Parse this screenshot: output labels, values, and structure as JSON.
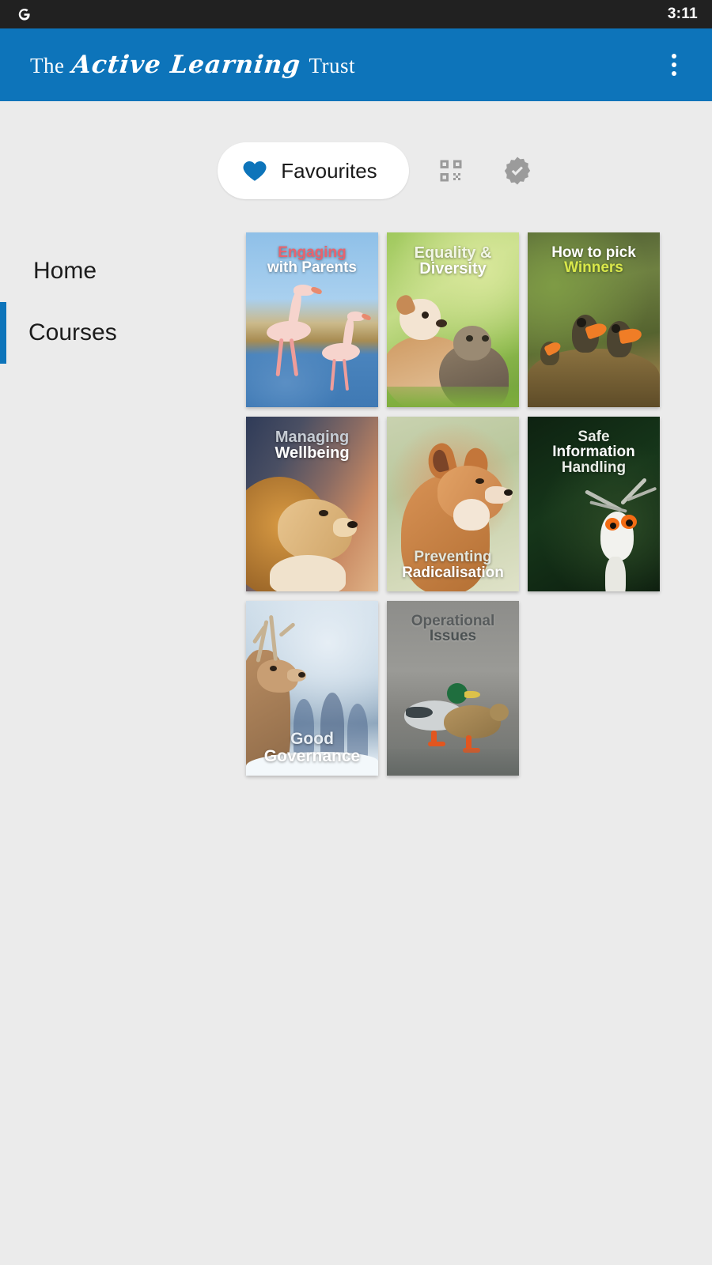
{
  "status_bar": {
    "left_icon": "google-g-icon",
    "time": "3:11"
  },
  "app_bar": {
    "brand_prefix": "The",
    "brand_script": "Active Learning",
    "brand_suffix": "Trust",
    "overflow_icon": "more-vert-icon",
    "background_color": "#0d74ba"
  },
  "tabs": [
    {
      "id": "favourites",
      "label": "Favourites",
      "icon": "heart-icon",
      "selected": true
    },
    {
      "id": "qr",
      "label": "",
      "icon": "qr-code-icon",
      "selected": false
    },
    {
      "id": "certified",
      "label": "",
      "icon": "verified-badge-icon",
      "selected": false
    }
  ],
  "sidebar": {
    "items": [
      {
        "label": "Home",
        "active": false
      },
      {
        "label": "Courses",
        "active": true
      }
    ],
    "active_indicator_color": "#0d74ba"
  },
  "courses": [
    {
      "title_lines": [
        "Engaging",
        "with Parents"
      ],
      "line_colors": [
        "#e8636e",
        "#ffffff"
      ],
      "title_position": "top",
      "font_size": "19px",
      "art": "art-flamingo",
      "image_alt": "two flamingos wading in blue water"
    },
    {
      "title_lines": [
        "Equality &",
        "Diversity"
      ],
      "line_colors": [
        "#f2f6e6",
        "#ffffff"
      ],
      "title_position": "top",
      "font_size": "20px",
      "art": "art-green",
      "image_alt": "puppy and kitten in grass"
    },
    {
      "title_lines": [
        "How to pick",
        "Winners"
      ],
      "line_colors": [
        "#ffffff",
        "#d9e84a"
      ],
      "title_position": "top",
      "font_size": "19px",
      "art": "art-nest",
      "image_alt": "baby birds in a nest with open beaks"
    },
    {
      "title_lines": [
        "Managing",
        "Wellbeing"
      ],
      "line_colors": [
        "#c6ccd4",
        "#ffffff"
      ],
      "title_position": "top",
      "font_size": "20px",
      "art": "art-lion",
      "image_alt": "lion in profile"
    },
    {
      "title_lines": [
        "Preventing",
        "Radicalisation"
      ],
      "line_colors": [
        "#e2e6dd",
        "#ffffff"
      ],
      "title_position": "bottom",
      "font_size": "19px",
      "art": "art-fox",
      "image_alt": "red fox in profile"
    },
    {
      "title_lines": [
        "Safe",
        "Information",
        "Handling"
      ],
      "line_colors": [
        "#e8ece6",
        "#ffffff",
        "#e8ece6"
      ],
      "title_position": "top",
      "font_size": "19px",
      "art": "art-darkgreen",
      "image_alt": "secretary bird against dark green foliage"
    },
    {
      "title_lines": [
        "Good",
        "Governance"
      ],
      "line_colors": [
        "#e9eff5",
        "#ffffff"
      ],
      "title_position": "bottom",
      "font_size": "21px",
      "art": "art-snow",
      "image_alt": "deer in a snowy forest"
    },
    {
      "title_lines": [
        "Operational",
        "Issues"
      ],
      "line_colors": [
        "#575b5c",
        "#4b5152"
      ],
      "title_position": "top",
      "font_size": "19px",
      "art": "art-duck",
      "image_alt": "two mallard ducks standing on ice"
    }
  ],
  "theme": {
    "page_background": "#ebebeb",
    "accent": "#0d74ba",
    "status_bar_background": "#212121"
  }
}
